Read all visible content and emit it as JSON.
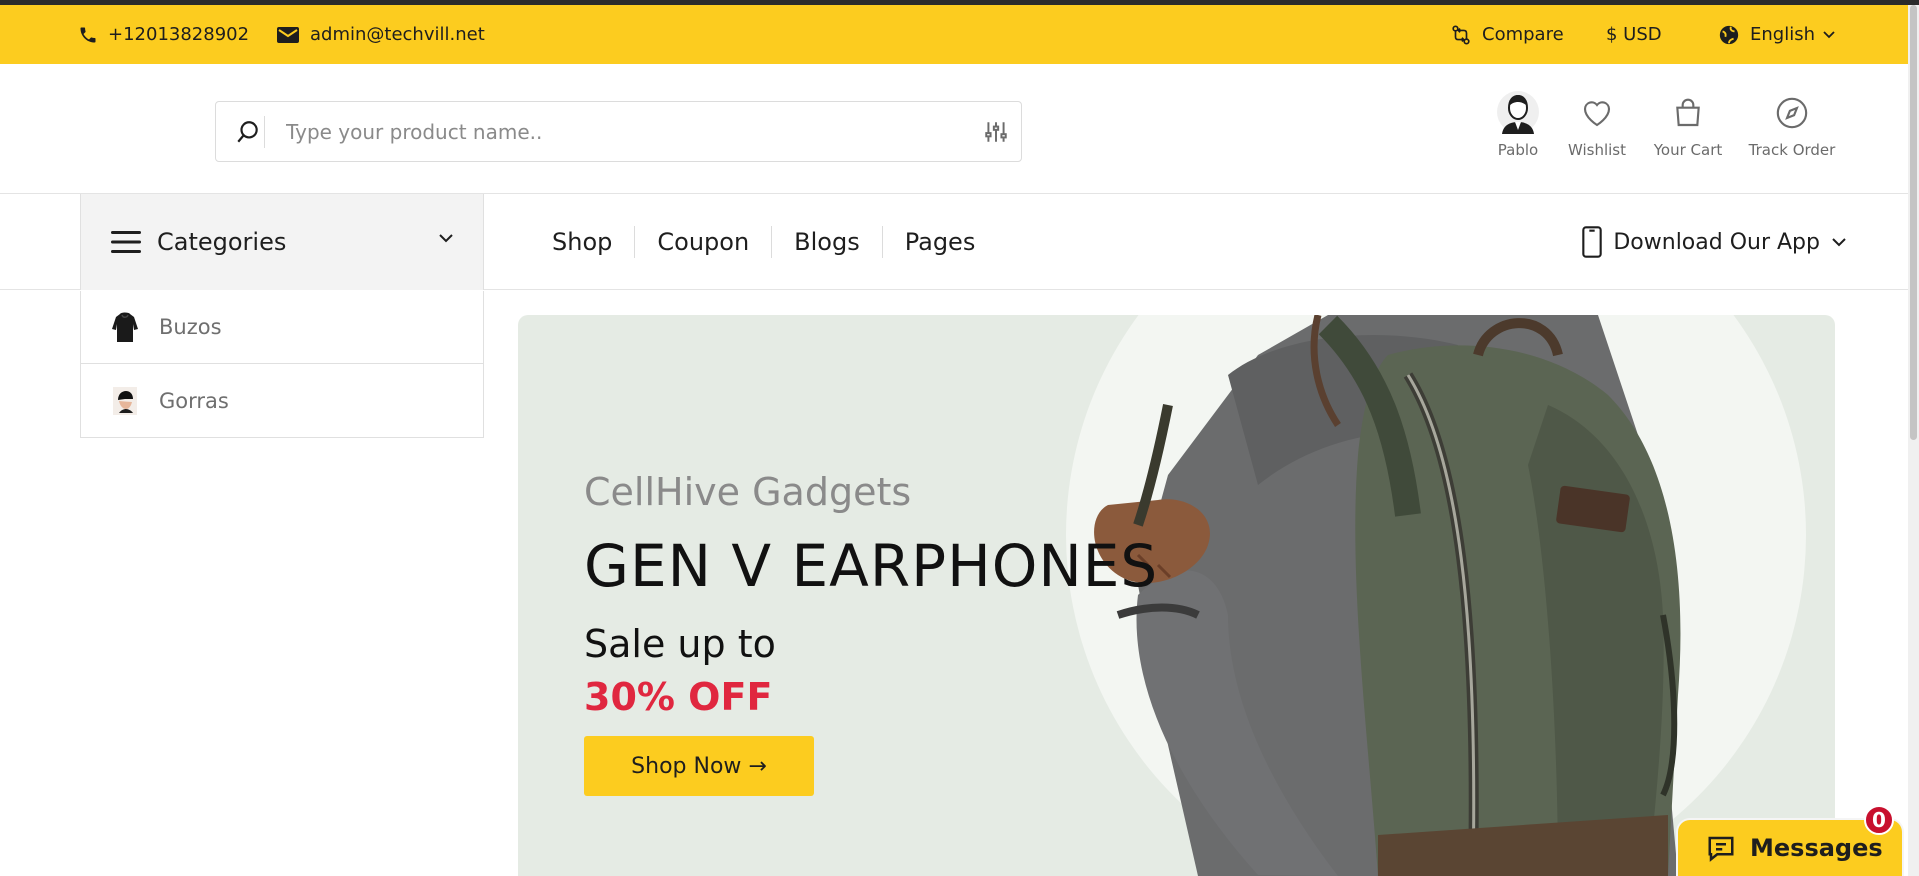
{
  "topbar": {
    "phone": "+12013828902",
    "email": "admin@techvill.net",
    "compare_label": "Compare",
    "currency_label": "$ USD",
    "language_label": "English",
    "bg_color": "#fccc1f"
  },
  "header": {
    "search_placeholder": "Type your product name..",
    "icons": [
      {
        "name": "user-avatar",
        "label": "Pablo"
      },
      {
        "name": "heart-icon",
        "label": "Wishlist"
      },
      {
        "name": "bag-icon",
        "label": "Your Cart"
      },
      {
        "name": "compass-icon",
        "label": "Track Order"
      }
    ]
  },
  "nav": {
    "categories_label": "Categories",
    "links": [
      "Shop",
      "Coupon",
      "Blogs",
      "Pages"
    ],
    "download_app_label": "Download Our App"
  },
  "category_list": [
    {
      "label": "Buzos",
      "thumb": "hoodie-thumbnail"
    },
    {
      "label": "Gorras",
      "thumb": "cap-thumbnail"
    }
  ],
  "hero": {
    "brand": "CellHive Gadgets",
    "title": "GEN V EARPHONES",
    "sale_text": "Sale up to",
    "discount": "30% OFF",
    "cta_label": "Shop Now →",
    "accent_color": "#e0273f",
    "bg_color": "#e5ebe4"
  },
  "messages": {
    "label": "Messages",
    "count": "0"
  }
}
